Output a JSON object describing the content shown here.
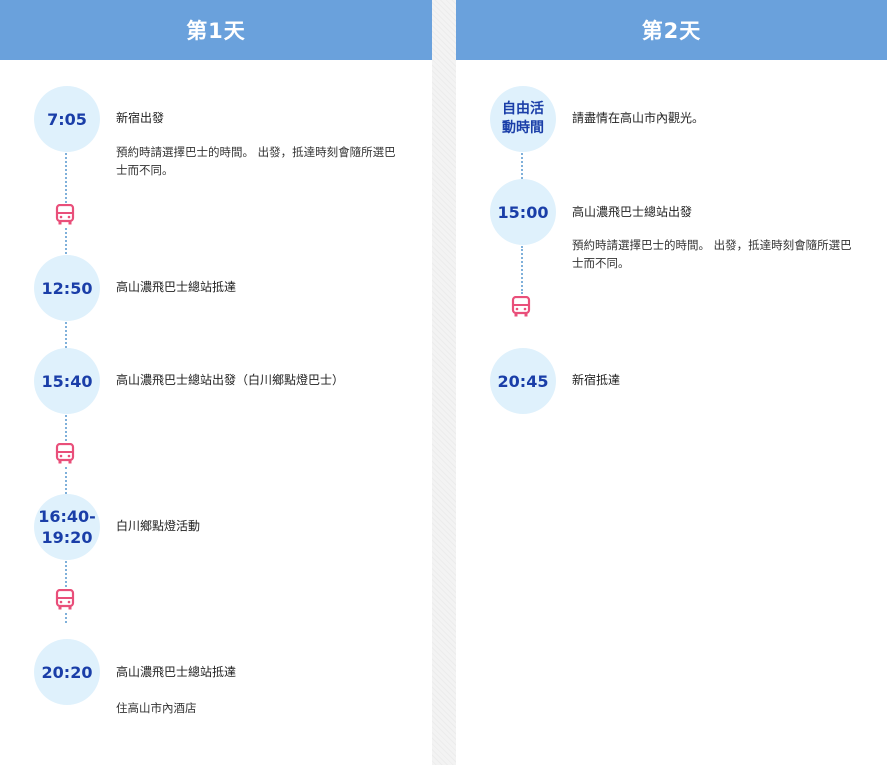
{
  "days": [
    {
      "header": "第1天",
      "stops": [
        {
          "time": "7:05",
          "title": "新宿出發",
          "desc": "預約時請選擇巴士的時間。 出發，抵達時刻會隨所選巴士而不同。"
        },
        {
          "time": "12:50",
          "title": "高山濃飛巴士總站抵達"
        },
        {
          "time": "15:40",
          "title": "高山濃飛巴士總站出發（白川鄉點燈巴士）"
        },
        {
          "time": "16:40-\n19:20",
          "title": "白川鄉點燈活動"
        },
        {
          "time": "20:20",
          "title": "高山濃飛巴士總站抵達",
          "desc": "住高山市內酒店"
        }
      ]
    },
    {
      "header": "第2天",
      "stops": [
        {
          "time": "自由活\n動時間",
          "title": "請盡情在高山市內觀光。"
        },
        {
          "time": "15:00",
          "title": "高山濃飛巴士總站出發",
          "desc": "預約時請選擇巴士的時間。 出發，抵達時刻會隨所選巴士而不同。"
        },
        {
          "time": "20:45",
          "title": "新宿抵達"
        }
      ]
    }
  ],
  "icons": {
    "transport": "bus-icon"
  },
  "colors": {
    "header_bg": "#6aa1dc",
    "bubble_bg": "#dff1fc",
    "time_text": "#1a3ea8",
    "bus": "#e94f7a",
    "connector": "#7fb0da"
  }
}
